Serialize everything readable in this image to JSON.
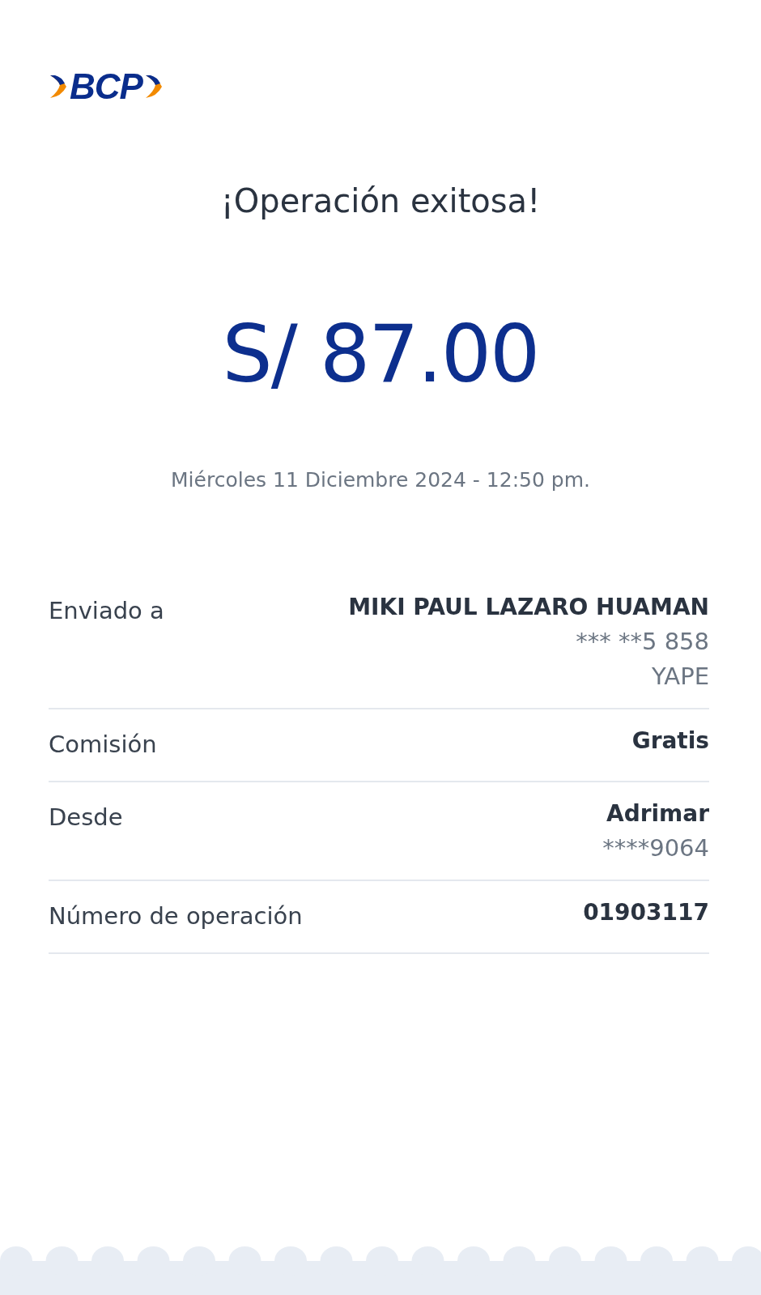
{
  "logo": {
    "text": "BCP"
  },
  "title": "¡Operación exitosa!",
  "amount": "S/ 87.00",
  "datetime": "Miércoles 11 Diciembre 2024 - 12:50 pm.",
  "details": [
    {
      "label": "Enviado a",
      "values": [
        "MIKI PAUL LAZARO HUAMAN",
        "*** **5 858",
        "YAPE"
      ]
    },
    {
      "label": "Comisión",
      "values": [
        "Gratis"
      ]
    },
    {
      "label": "Desde",
      "values": [
        "Adrimar",
        "****9064"
      ]
    },
    {
      "label": "Número de operación",
      "values": [
        "01903117"
      ]
    }
  ]
}
